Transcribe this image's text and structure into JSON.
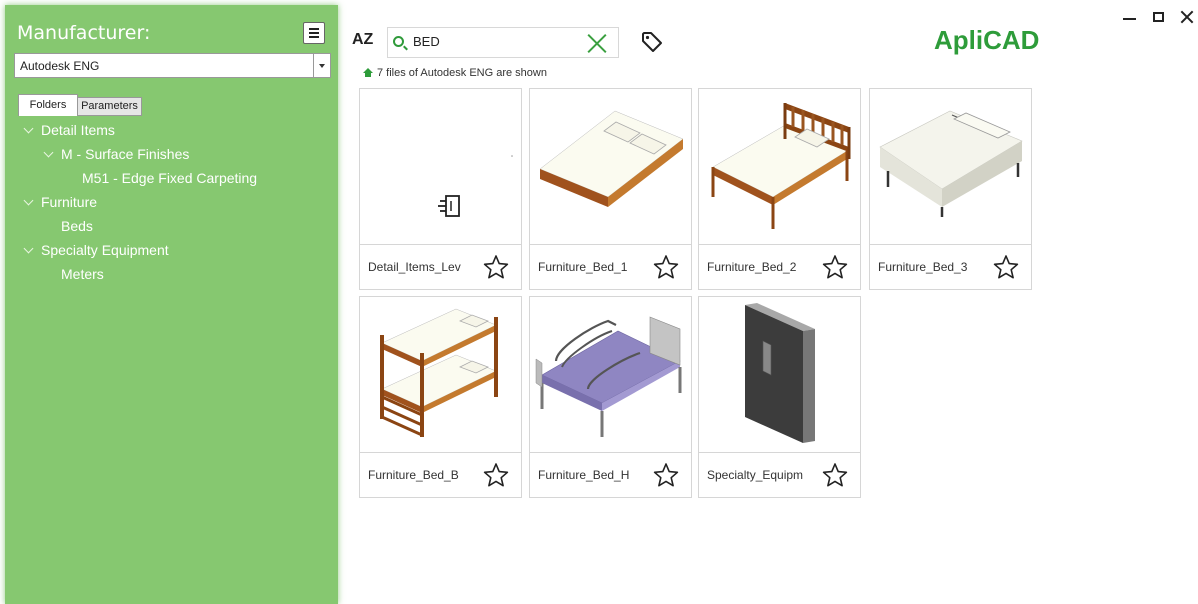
{
  "sidebar": {
    "title": "Manufacturer:",
    "manufacturer_value": "Autodesk ENG",
    "tabs": {
      "folders": "Folders",
      "parameters": "Parameters"
    },
    "tree": [
      {
        "label": "Detail Items",
        "level": 0,
        "expanded": true
      },
      {
        "label": "M - Surface Finishes",
        "level": 1,
        "expanded": true
      },
      {
        "label": "M51 - Edge Fixed Carpeting",
        "level": 2,
        "expanded": false
      },
      {
        "label": "Furniture",
        "level": 0,
        "expanded": true
      },
      {
        "label": "Beds",
        "level": 1,
        "expanded": false
      },
      {
        "label": "Specialty Equipment",
        "level": 0,
        "expanded": true
      },
      {
        "label": "Meters",
        "level": 1,
        "expanded": false
      }
    ]
  },
  "toolbar": {
    "sort_label": "AZ",
    "search_value": "BED",
    "status": "7 files of Autodesk ENG are shown"
  },
  "brand": "ApliCAD",
  "cards": [
    {
      "name": "Detail_Items_Lev",
      "thumb": "detail-item-icon"
    },
    {
      "name": "Furniture_Bed_1",
      "thumb": "bed-1"
    },
    {
      "name": "Furniture_Bed_2",
      "thumb": "bed-2"
    },
    {
      "name": "Furniture_Bed_3",
      "thumb": "bed-3"
    },
    {
      "name": "Furniture_Bed_B",
      "thumb": "bunk-bed"
    },
    {
      "name": "Furniture_Bed_H",
      "thumb": "hospital-bed"
    },
    {
      "name": "Specialty_Equipm",
      "thumb": "specialty-equipment"
    }
  ],
  "colors": {
    "sidebar_bg": "#86c870",
    "brand": "#2e9c3a",
    "accent_green": "#3aa040"
  }
}
